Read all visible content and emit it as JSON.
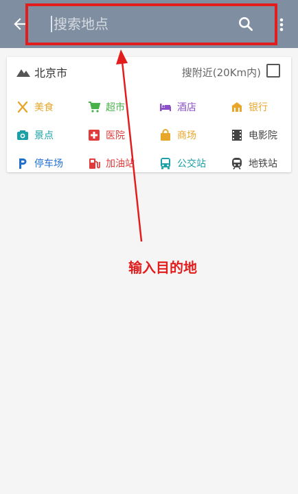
{
  "header": {
    "search_placeholder": "搜索地点"
  },
  "card": {
    "city": "北京市",
    "nearby_label": "搜附近(20Km内)",
    "categories": [
      {
        "label": "美食",
        "icon": "utensils-icon",
        "color": "#e8a62a"
      },
      {
        "label": "超市",
        "icon": "cart-icon",
        "color": "#48b14a"
      },
      {
        "label": "酒店",
        "icon": "bed-icon",
        "color": "#8b4fc7"
      },
      {
        "label": "银行",
        "icon": "bank-icon",
        "color": "#e8a62a"
      },
      {
        "label": "景点",
        "icon": "camera-icon",
        "color": "#1ba0a8"
      },
      {
        "label": "医院",
        "icon": "hospital-icon",
        "color": "#e03a3a"
      },
      {
        "label": "商场",
        "icon": "shopping-bag-icon",
        "color": "#e8a62a"
      },
      {
        "label": "电影院",
        "icon": "film-icon",
        "color": "#444444"
      },
      {
        "label": "停车场",
        "icon": "parking-icon",
        "color": "#1e6fd0"
      },
      {
        "label": "加油站",
        "icon": "gas-station-icon",
        "color": "#e03a3a"
      },
      {
        "label": "公交站",
        "icon": "bus-icon",
        "color": "#1ba0a8"
      },
      {
        "label": "地铁站",
        "icon": "subway-icon",
        "color": "#444444"
      }
    ]
  },
  "annotation": {
    "text": "输入目的地",
    "color": "#e21d1d"
  },
  "colors": {
    "toolbar": "#7f8ea0",
    "highlight": "#e21d1d"
  }
}
